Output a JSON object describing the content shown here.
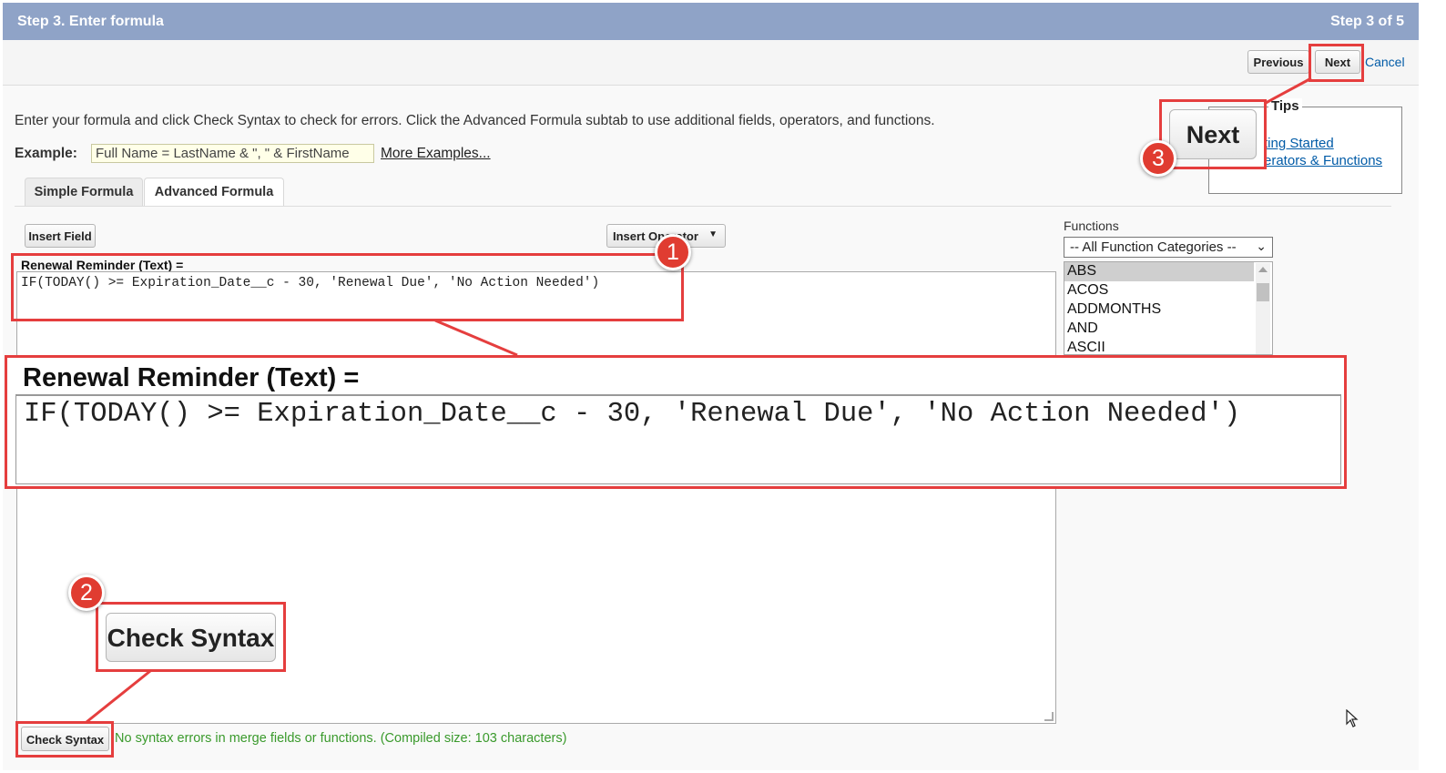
{
  "header": {
    "title": "Step 3. Enter formula",
    "step": "Step 3 of 5"
  },
  "toolbar": {
    "previous_label": "Previous",
    "next_label": "Next",
    "cancel_label": "Cancel"
  },
  "intro": "Enter your formula and click Check Syntax to check for errors. Click the Advanced Formula subtab to use additional fields, operators, and functions.",
  "example": {
    "label": "Example:",
    "value": "Full Name = LastName & \", \" & FirstName",
    "more_link": "More Examples..."
  },
  "tabs": [
    {
      "label": "Simple Formula"
    },
    {
      "label": "Advanced Formula"
    }
  ],
  "editor": {
    "insert_field_label": "Insert Field",
    "insert_operator_label": "Insert Operator",
    "field_label": "Renewal Reminder (Text) =",
    "formula": "IF(TODAY() >= Expiration_Date__c - 30, 'Renewal Due', 'No Action Needed')"
  },
  "functions": {
    "label": "Functions",
    "category": "-- All Function Categories --",
    "items": [
      "ABS",
      "ACOS",
      "ADDMONTHS",
      "AND",
      "ASCII"
    ],
    "selected": "ABS"
  },
  "tips": {
    "title": "Tips",
    "links": [
      "ting Started",
      "erators & Functions"
    ]
  },
  "check_syntax_label": "Check Syntax",
  "status_message": "No syntax errors in merge fields or functions. (Compiled size: 103 characters)",
  "callouts": {
    "badge_1": "1",
    "badge_2": "2",
    "badge_3": "3",
    "zoom_field_label": "Renewal Reminder (Text) =",
    "zoom_formula": "IF(TODAY() >= Expiration_Date__c - 30, 'Renewal Due', 'No Action Needed')",
    "zoom_check_syntax": "Check Syntax",
    "zoom_next": "Next",
    "highlight_color": "#e53e3e"
  },
  "colors": {
    "header_bg": "#8fa3c7",
    "link": "#015ba7",
    "success": "#3a9a2c"
  }
}
